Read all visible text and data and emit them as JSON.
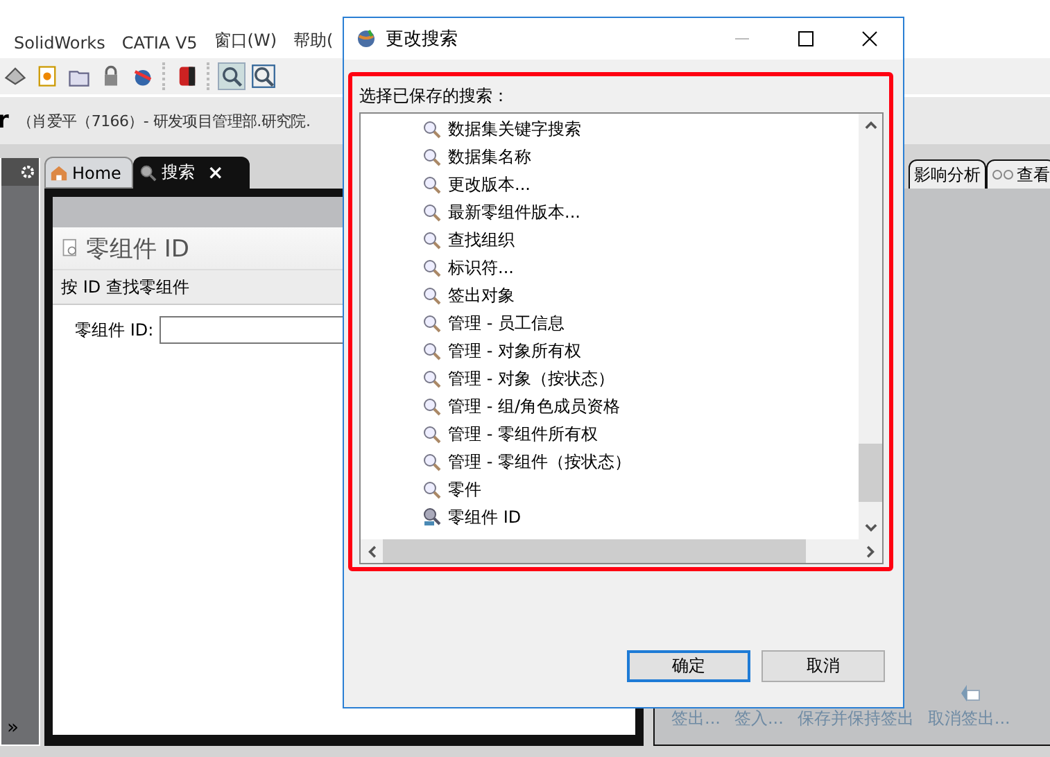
{
  "menu": [
    "SolidWorks",
    "CATIA V5",
    "窗口(W)",
    "帮助("
  ],
  "header": {
    "title": "r",
    "user_info": "（肖爱平（7166）- 研发项目管理部.研究院."
  },
  "left_panel": {
    "expand_glyph": "»"
  },
  "tabs": [
    {
      "label": "Home",
      "selected": false
    },
    {
      "label": "搜索",
      "selected": true,
      "close": "×"
    }
  ],
  "search_panel": {
    "title": "零组件 ID",
    "subtitle": "按 ID 查找零组件",
    "field_label": "零组件 ID:"
  },
  "right_tabs": [
    {
      "label": "影响分析",
      "kind": "plain"
    },
    {
      "label": "查看",
      "kind": "viewer"
    }
  ],
  "actions": [
    {
      "label": "签出...",
      "disabled": true
    },
    {
      "label": "签入...",
      "disabled": true
    },
    {
      "label": "保存并保持签出",
      "disabled": true
    },
    {
      "label": "取消签出...",
      "disabled": true
    }
  ],
  "dialog": {
    "title": "更改搜索",
    "prompt": "选择已保存的搜索：",
    "saved_searches": [
      {
        "label": "数据集关键字搜索",
        "kind": "search"
      },
      {
        "label": "数据集名称",
        "kind": "search"
      },
      {
        "label": "更改版本...",
        "kind": "search"
      },
      {
        "label": "最新零组件版本...",
        "kind": "search"
      },
      {
        "label": "查找组织",
        "kind": "search"
      },
      {
        "label": "标识符...",
        "kind": "search"
      },
      {
        "label": "签出对象",
        "kind": "search"
      },
      {
        "label": "管理 - 员工信息",
        "kind": "search"
      },
      {
        "label": "管理 - 对象所有权",
        "kind": "search"
      },
      {
        "label": "管理 - 对象（按状态）",
        "kind": "search"
      },
      {
        "label": "管理 - 组/角色成员资格",
        "kind": "search"
      },
      {
        "label": "管理 - 零组件所有权",
        "kind": "search"
      },
      {
        "label": "管理 - 零组件（按状态）",
        "kind": "search"
      },
      {
        "label": "零件",
        "kind": "search"
      },
      {
        "label": "零组件 ID",
        "kind": "item-search"
      }
    ],
    "buttons": [
      {
        "label": "确定",
        "default": true
      },
      {
        "label": "取消",
        "default": false
      }
    ]
  }
}
